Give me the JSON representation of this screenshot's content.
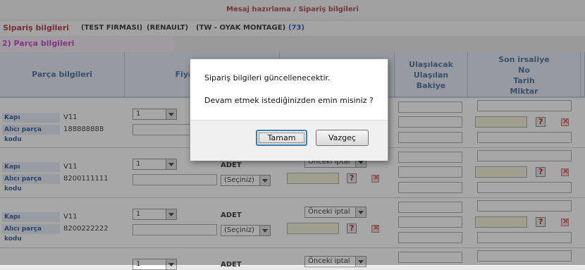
{
  "header": {
    "breadcrumb": "Mesaj hazırlama / Sipariş bilgileri"
  },
  "order": {
    "title": "Sipariş bilgileri",
    "company": "(TEST FIRMASI)",
    "brand": "(RENAULT)",
    "plant": "(TW - OYAK MONTAGE)",
    "count": "(73)"
  },
  "section": {
    "title": "2) Parça bilgileri"
  },
  "columns": {
    "parca": "Parça bilgileri",
    "fiyat": "Fiya",
    "ulas1": "Ulaşılacak",
    "ulas2": "Ulaşılan",
    "ulas3": "Bakiye",
    "son1": "Son irsaliye",
    "son2": "No",
    "son3": "Tarih",
    "son4": "Miktar"
  },
  "rows": [
    {
      "kapi_label": "Kapı",
      "kapi_value": "V11",
      "alici_label": "Alıcı parça kodu",
      "alici_value": "188888888",
      "qty_select": "1",
      "unit": "",
      "currency_select": "",
      "status_select": ""
    },
    {
      "kapi_label": "Kapı",
      "kapi_value": "V11",
      "alici_label": "Alıcı parça kodu",
      "alici_value": "8200111111",
      "qty_select": "1",
      "unit": "ADET",
      "currency_select": "(Seçiniz)",
      "status_select": "Önceki iptal"
    },
    {
      "kapi_label": "Kapı",
      "kapi_value": "V11",
      "alici_label": "Alıcı parça kodu",
      "alici_value": "8200222222",
      "qty_select": "1",
      "unit": "ADET",
      "currency_select": "(Seçiniz)",
      "status_select": "Önceki iptal"
    },
    {
      "kapi_label": "",
      "kapi_value": "",
      "alici_label": "",
      "alici_value": "",
      "qty_select": "1",
      "unit": "ADET",
      "currency_select": "",
      "status_select": "Önceki iptal"
    }
  ],
  "dialog": {
    "line1": "Sipariş bilgileri güncellenecektir.",
    "line2": "Devam etmek istediğinizden emin misiniz ?",
    "ok_label": "Tamam",
    "cancel_label": "Vazgeç"
  }
}
